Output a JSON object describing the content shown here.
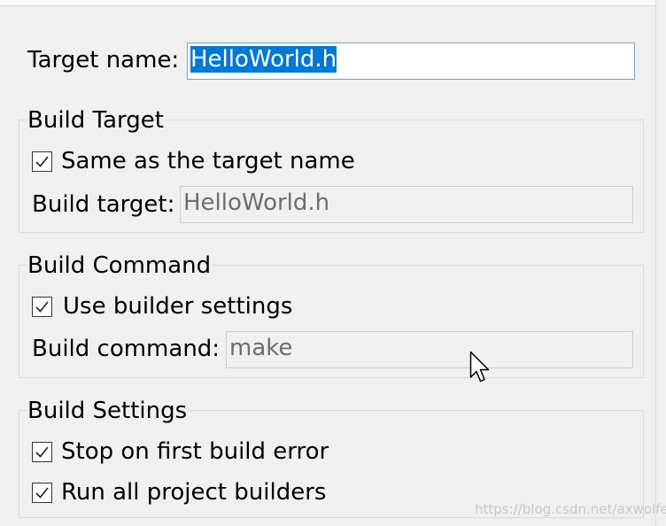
{
  "target_name": {
    "label": "Target name:",
    "value": "HelloWorld.h"
  },
  "build_target": {
    "group_title": "Build Target",
    "same_as_target_checkbox": "Same as the target name",
    "field_label": "Build target:",
    "field_value": "HelloWorld.h"
  },
  "build_command": {
    "group_title": "Build Command",
    "use_builder_checkbox": "Use builder settings",
    "field_label": "Build command:",
    "field_value": "make"
  },
  "build_settings": {
    "group_title": "Build Settings",
    "stop_on_error_checkbox": "Stop on first build error",
    "run_all_builders_checkbox": "Run all project builders"
  },
  "watermark": "https://blog.csdn.net/axwolfer"
}
